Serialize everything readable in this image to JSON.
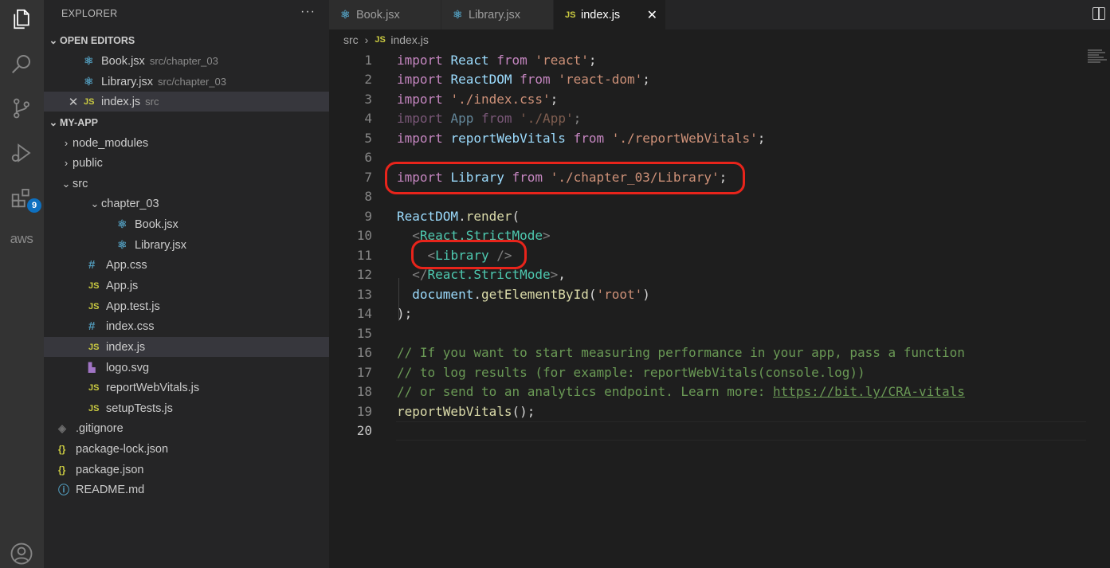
{
  "activity_bar": {
    "icons": [
      "explorer-icon",
      "search-icon",
      "source-control-icon",
      "run-debug-icon",
      "extensions-icon",
      "account-icon"
    ],
    "extensions_badge": "9",
    "aws_label": "aws"
  },
  "explorer": {
    "title": "EXPLORER",
    "more": "···",
    "open_editors": {
      "label": "OPEN EDITORS",
      "items": [
        {
          "name": "Book.jsx",
          "path": "src/chapter_03"
        },
        {
          "name": "Library.jsx",
          "path": "src/chapter_03"
        },
        {
          "name": "index.js",
          "path": "src"
        }
      ]
    },
    "project": {
      "label": "MY-APP",
      "items": [
        {
          "name": "node_modules"
        },
        {
          "name": "public"
        },
        {
          "name": "src"
        },
        {
          "name": "chapter_03"
        },
        {
          "name": "Book.jsx"
        },
        {
          "name": "Library.jsx"
        },
        {
          "name": "App.css"
        },
        {
          "name": "App.js"
        },
        {
          "name": "App.test.js"
        },
        {
          "name": "index.css"
        },
        {
          "name": "index.js"
        },
        {
          "name": "logo.svg"
        },
        {
          "name": "reportWebVitals.js"
        },
        {
          "name": "setupTests.js"
        },
        {
          "name": ".gitignore"
        },
        {
          "name": "package-lock.json"
        },
        {
          "name": "package.json"
        },
        {
          "name": "README.md"
        }
      ]
    }
  },
  "tabs": [
    {
      "label": "Book.jsx",
      "active": false
    },
    {
      "label": "Library.jsx",
      "active": false
    },
    {
      "label": "index.js",
      "active": true
    }
  ],
  "breadcrumb": {
    "folder": "src",
    "file": "index.js"
  },
  "editor": {
    "line_numbers": [
      "1",
      "2",
      "3",
      "4",
      "5",
      "6",
      "7",
      "8",
      "9",
      "10",
      "11",
      "12",
      "13",
      "14",
      "15",
      "16",
      "17",
      "18",
      "19",
      "20"
    ],
    "current_line": "20",
    "tokens": {
      "import": "import",
      "from": "from",
      "React": "React",
      "ReactDOM": "ReactDOM",
      "App": "App",
      "reportWebVitals": "reportWebVitals",
      "Library": "Library",
      "s_react": "'react'",
      "s_react_dom": "'react-dom'",
      "s_index_css": "'./index.css'",
      "s_app": "'./App'",
      "s_rwv": "'./reportWebVitals'",
      "s_library": "'./chapter_03/Library'",
      "render": "render",
      "strict_mode": "React.StrictMode",
      "document": "document",
      "getElementById": "getElementById",
      "s_root": "'root'",
      "comment_16": "// If you want to start measuring performance in your app, pass a function",
      "comment_17": "// to log results (for example: reportWebVitals(console.log))",
      "comment_18_prefix": "// or send to an analytics endpoint. Learn more: ",
      "comment_18_link": "https://bit.ly/CRA-vitals",
      "rwv_call": "reportWebVitals"
    }
  },
  "colors": {
    "annotation": "#e8241b",
    "keyword": "#c586c0",
    "variable": "#9cdcfe",
    "string": "#ce9178",
    "comment": "#6a9955",
    "jsx_tag": "#4ec9b0"
  }
}
